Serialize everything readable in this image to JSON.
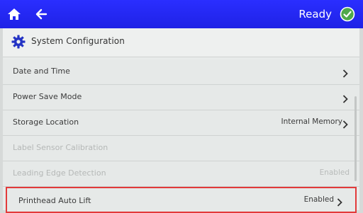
{
  "status_bar": {
    "status": "Ready",
    "icons": {
      "home": "home-icon",
      "back": "back-arrow-icon",
      "status": "check-circle-icon"
    }
  },
  "panel": {
    "title": "System Configuration",
    "title_icon": "gear-icon"
  },
  "rows": [
    {
      "label": "Date and Time",
      "value": ""
    },
    {
      "label": "Power Save Mode",
      "value": ""
    },
    {
      "label": "Storage Location",
      "value": "Internal Memory"
    },
    {
      "label": "Label Sensor Calibration",
      "value": ""
    },
    {
      "label": "Leading Edge Detection",
      "value": "Enabled"
    },
    {
      "label": "Printhead Auto Lift",
      "value": "Enabled"
    }
  ],
  "colors": {
    "accent": "#2a2eff",
    "highlight": "#e23a3a",
    "ready": "#4fa84a"
  }
}
